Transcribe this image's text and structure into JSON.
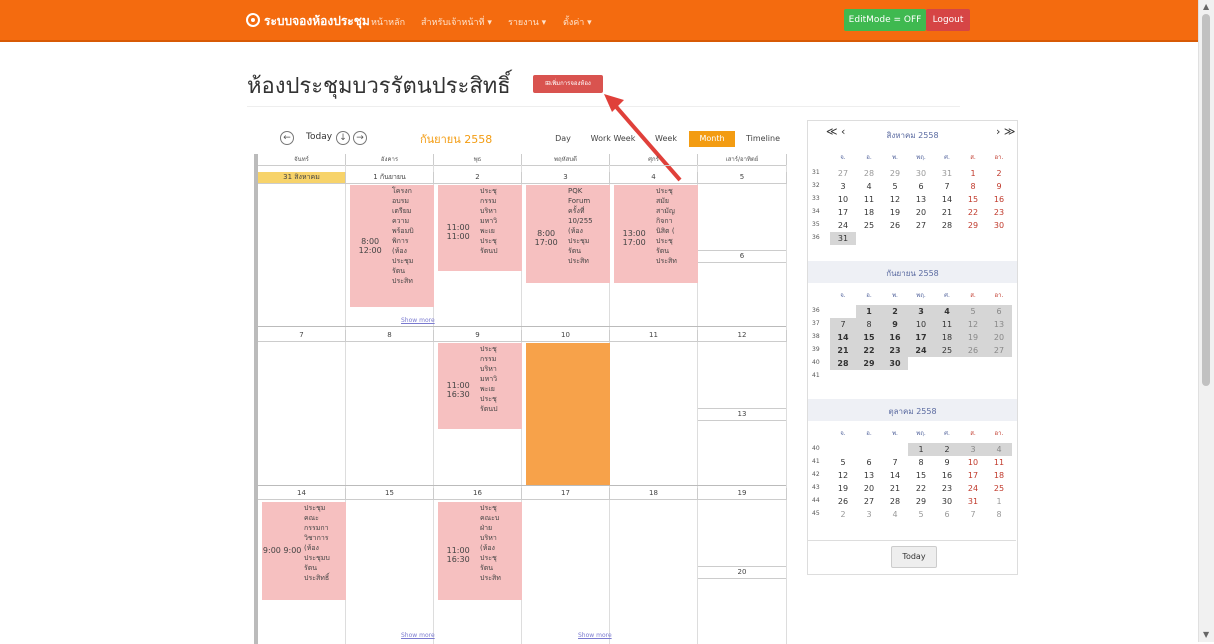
{
  "nav": {
    "brand": "ระบบจองห้องประชุม",
    "items": [
      "หน้าหลัก",
      "สำหรับเจ้าหน้าที่ ▾",
      "รายงาน ▾",
      "ตั้งค่า ▾"
    ],
    "editmode": "EditMode = OFF",
    "logout": "Logout"
  },
  "page": {
    "title": "ห้องประชุมบวรรัตนประสิทธิ์",
    "add_button": "เพิ่มการจองห้อง"
  },
  "calendar": {
    "today_label": "Today",
    "month_title": "กันยายน 2558",
    "views": [
      "Day",
      "Work Week",
      "Week",
      "Month",
      "Timeline"
    ],
    "active_view": "Month",
    "dow": [
      "จันทร์",
      "อังคาร",
      "พุธ",
      "พฤหัสบดี",
      "ศุกร์",
      "เสาร์/อาทิตย์"
    ],
    "week1": [
      "31 สิงหาคม",
      "1 กันยายน",
      "2",
      "3",
      "4",
      "5"
    ],
    "week1_sun": "6",
    "week2": [
      "7",
      "8",
      "9",
      "10",
      "11",
      "12"
    ],
    "week2_sun": "13",
    "week3": [
      "14",
      "15",
      "16",
      "17",
      "18",
      "19"
    ],
    "week3_sun": "20",
    "show_more": "Show more",
    "events": [
      {
        "time": "8:00 12:00",
        "desc": "โครงก\nอบรม\nเตรียม\nความ\nพร้อมบิ\nพิการ\n(ห้อง\nประชุม\nรัตน\nประสิท"
      },
      {
        "time": "11:00 11:00",
        "desc": "ประชุ\nกรรม\nบริหา\nมหาวิ\nพะเย\nประชุ\nรัตนป"
      },
      {
        "time": "8:00 17:00",
        "desc": "PQK\nForum\nครั้งที่\n10/255\n(ห้อง\nประชุม\nรัตน\nประสิท"
      },
      {
        "time": "13:00 17:00",
        "desc": "ประชุ\nสมัย\nสามัญ\nกิจกา\nนิสิต (\nประชุ\nรัตน\nประสิท"
      },
      {
        "time": "11:00 16:30",
        "desc": "ประชุ\nกรรม\nบริหา\nมหาวิ\nพะเย\nประชุ\nรัตนป"
      },
      {
        "time": "9:00 9:00",
        "desc": "ประชุม\nคณะ\nกรรมกา\nวิชาการ\n(ห้อง\nประชุมบ\nรัตน\nประสิทธิ์"
      },
      {
        "time": "11:00 16:30",
        "desc": "ประชุ\nคณะบ\nฝ่าย\nบริหา\n(ห้อง\nประชุ\nรัตน\nประสิท"
      }
    ]
  },
  "mini": {
    "nav_left": "≪ ‹",
    "nav_right": "› ≫",
    "dow": [
      "จ.",
      "อ.",
      "พ.",
      "พฤ.",
      "ศ.",
      "ส.",
      "อา."
    ],
    "months": [
      {
        "title": "สิงหาคม 2558",
        "rows": [
          [
            "31",
            "27",
            "28",
            "29",
            "30",
            "31",
            "1",
            "2"
          ],
          [
            "32",
            "3",
            "4",
            "5",
            "6",
            "7",
            "8",
            "9"
          ],
          [
            "33",
            "10",
            "11",
            "12",
            "13",
            "14",
            "15",
            "16"
          ],
          [
            "34",
            "17",
            "18",
            "19",
            "20",
            "21",
            "22",
            "23"
          ],
          [
            "35",
            "24",
            "25",
            "26",
            "27",
            "28",
            "29",
            "30"
          ],
          [
            "36",
            "31",
            "",
            "",
            "",
            "",
            "",
            ""
          ]
        ]
      },
      {
        "title": "กันยายน 2558",
        "rows": [
          [
            "36",
            "",
            "1",
            "2",
            "3",
            "4",
            "5",
            "6"
          ],
          [
            "37",
            "7",
            "8",
            "9",
            "10",
            "11",
            "12",
            "13"
          ],
          [
            "38",
            "14",
            "15",
            "16",
            "17",
            "18",
            "19",
            "20"
          ],
          [
            "39",
            "21",
            "22",
            "23",
            "24",
            "25",
            "26",
            "27"
          ],
          [
            "40",
            "28",
            "29",
            "30",
            "",
            "",
            "",
            ""
          ],
          [
            "41",
            "",
            "",
            "",
            "",
            "",
            "",
            ""
          ]
        ]
      },
      {
        "title": "ตุลาคม 2558",
        "rows": [
          [
            "40",
            "",
            "",
            "",
            "1",
            "2",
            "3",
            "4"
          ],
          [
            "41",
            "5",
            "6",
            "7",
            "8",
            "9",
            "10",
            "11"
          ],
          [
            "42",
            "12",
            "13",
            "14",
            "15",
            "16",
            "17",
            "18"
          ],
          [
            "43",
            "19",
            "20",
            "21",
            "22",
            "23",
            "24",
            "25"
          ],
          [
            "44",
            "26",
            "27",
            "28",
            "29",
            "30",
            "31",
            "1"
          ],
          [
            "45",
            "2",
            "3",
            "4",
            "5",
            "6",
            "7",
            "8"
          ]
        ]
      }
    ],
    "today_button": "Today"
  },
  "colors": {
    "accent": "#f46b0f",
    "event": "#f6c0c0",
    "highlight": "#f7a24a"
  }
}
